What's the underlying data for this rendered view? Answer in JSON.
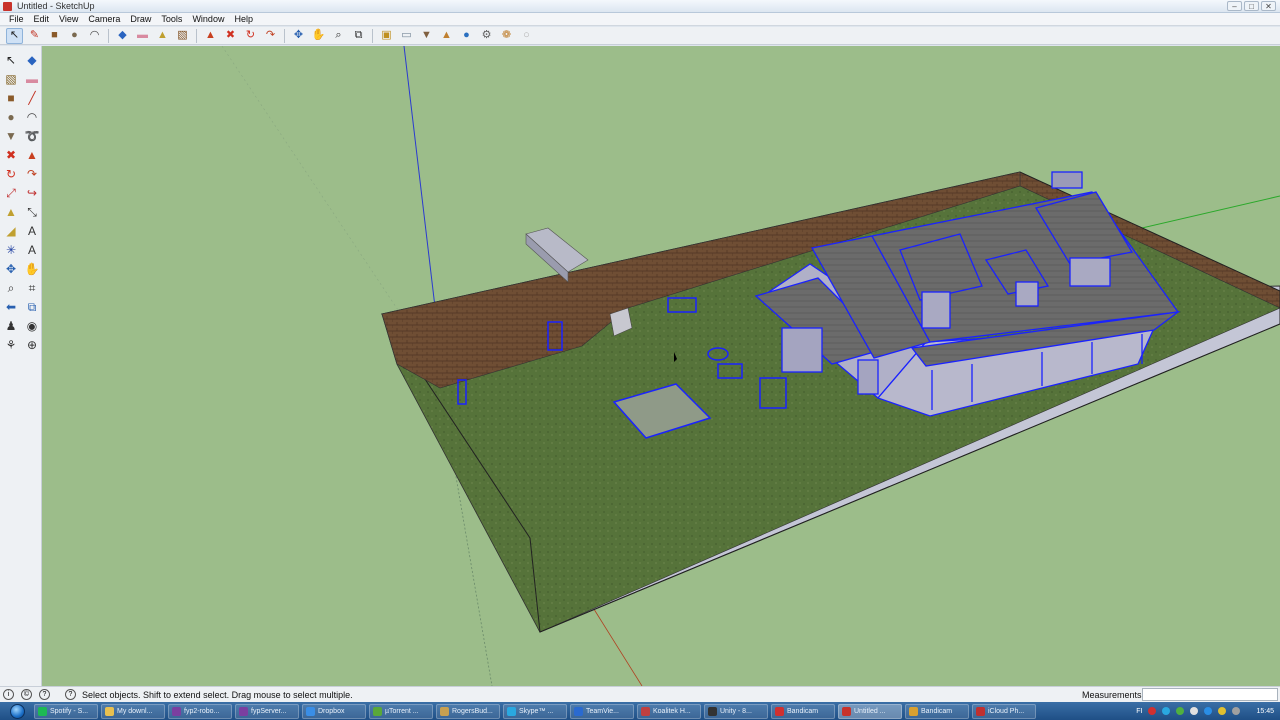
{
  "window": {
    "title": "Untitled - SketchUp",
    "controls": [
      "–",
      "□",
      "✕"
    ]
  },
  "menu": [
    "File",
    "Edit",
    "View",
    "Camera",
    "Draw",
    "Tools",
    "Window",
    "Help"
  ],
  "toolbar": [
    {
      "name": "select-tool",
      "glyph": "↖",
      "color": "#222",
      "active": true
    },
    {
      "name": "pencil-tool",
      "glyph": "✎",
      "color": "#c03020"
    },
    {
      "name": "rectangle-tool",
      "glyph": "■",
      "color": "#8a5a2a"
    },
    {
      "name": "circle-tool",
      "glyph": "●",
      "color": "#7a6a50"
    },
    {
      "name": "arc-tool",
      "glyph": "◠",
      "color": "#444"
    },
    {
      "sep": true
    },
    {
      "name": "make-component-tool",
      "glyph": "◆",
      "color": "#2a64c0"
    },
    {
      "name": "eraser-tool",
      "glyph": "▬",
      "color": "#d88aa0"
    },
    {
      "name": "tape-measure-tool",
      "glyph": "▲",
      "color": "#c0a030"
    },
    {
      "name": "paint-bucket-tool",
      "glyph": "▧",
      "color": "#805020"
    },
    {
      "sep": true
    },
    {
      "name": "push-pull-tool",
      "glyph": "▲",
      "color": "#c84020"
    },
    {
      "name": "move-tool",
      "glyph": "✖",
      "color": "#d03020"
    },
    {
      "name": "rotate-tool",
      "glyph": "↻",
      "color": "#d03020"
    },
    {
      "name": "follow-me-tool",
      "glyph": "↷",
      "color": "#c04020"
    },
    {
      "sep": true
    },
    {
      "name": "orbit-tool",
      "glyph": "✥",
      "color": "#2860b0"
    },
    {
      "name": "pan-tool",
      "glyph": "✋",
      "color": "#806040"
    },
    {
      "name": "zoom-tool",
      "glyph": "⌕",
      "color": "#333"
    },
    {
      "name": "zoom-extents-tool",
      "glyph": "⧉",
      "color": "#333"
    },
    {
      "sep": true
    },
    {
      "name": "add-location-tool",
      "glyph": "▣",
      "color": "#c09020"
    },
    {
      "name": "toggle-terrain-tool",
      "glyph": "▭",
      "color": "#7a8a9a"
    },
    {
      "name": "get-models-tool",
      "glyph": "▼",
      "color": "#806040"
    },
    {
      "name": "share-model-tool",
      "glyph": "▲",
      "color": "#c08030"
    },
    {
      "name": "earth-tool",
      "glyph": "●",
      "color": "#2a70c0"
    },
    {
      "name": "extension-warehouse-tool",
      "glyph": "⚙",
      "color": "#606060"
    },
    {
      "name": "photo-textures-tool",
      "glyph": "❁",
      "color": "#c08030"
    },
    {
      "name": "preview-in-earth-tool",
      "glyph": "○",
      "color": "#b0b0b0"
    }
  ],
  "left_toolbar": [
    {
      "name": "select-tool",
      "glyph": "↖",
      "color": "#222"
    },
    {
      "name": "make-component-tool",
      "glyph": "◆",
      "color": "#2a64c0"
    },
    {
      "name": "paint-bucket-tool",
      "glyph": "▧",
      "color": "#806020"
    },
    {
      "name": "eraser-tool",
      "glyph": "▬",
      "color": "#d88aa0"
    },
    {
      "name": "rectangle-tool",
      "glyph": "■",
      "color": "#8a5a2a"
    },
    {
      "name": "line-tool",
      "glyph": "╱",
      "color": "#c03020"
    },
    {
      "name": "circle-tool",
      "glyph": "●",
      "color": "#7a6a50"
    },
    {
      "name": "arc-tool",
      "glyph": "◠",
      "color": "#444"
    },
    {
      "name": "polygon-tool",
      "glyph": "▼",
      "color": "#7a6a50"
    },
    {
      "name": "freehand-tool",
      "glyph": "➰",
      "color": "#444"
    },
    {
      "name": "move-tool",
      "glyph": "✖",
      "color": "#d03020"
    },
    {
      "name": "push-pull-tool",
      "glyph": "▲",
      "color": "#c84020"
    },
    {
      "name": "rotate-tool",
      "glyph": "↻",
      "color": "#d03020"
    },
    {
      "name": "follow-me-tool",
      "glyph": "↷",
      "color": "#c04020"
    },
    {
      "name": "scale-tool",
      "glyph": "⤢",
      "color": "#c03030"
    },
    {
      "name": "offset-tool",
      "glyph": "↪",
      "color": "#c03030"
    },
    {
      "name": "tape-measure-tool",
      "glyph": "▲",
      "color": "#c0a030"
    },
    {
      "name": "dimension-tool",
      "glyph": "⤡",
      "color": "#333"
    },
    {
      "name": "protractor-tool",
      "glyph": "◢",
      "color": "#c0a030"
    },
    {
      "name": "text-tool",
      "glyph": "A",
      "color": "#333"
    },
    {
      "name": "axes-tool",
      "glyph": "✳",
      "color": "#2040a0"
    },
    {
      "name": "3d-text-tool",
      "glyph": "A",
      "color": "#333"
    },
    {
      "name": "orbit-tool",
      "glyph": "✥",
      "color": "#2860b0"
    },
    {
      "name": "pan-tool",
      "glyph": "✋",
      "color": "#806040"
    },
    {
      "name": "zoom-tool",
      "glyph": "⌕",
      "color": "#333"
    },
    {
      "name": "zoom-window-tool",
      "glyph": "⌗",
      "color": "#333"
    },
    {
      "name": "previous-view-tool",
      "glyph": "⬅",
      "color": "#2860b0"
    },
    {
      "name": "zoom-extents-tool",
      "glyph": "⧉",
      "color": "#2860b0"
    },
    {
      "name": "position-camera-tool",
      "glyph": "♟",
      "color": "#333"
    },
    {
      "name": "look-around-tool",
      "glyph": "◉",
      "color": "#333"
    },
    {
      "name": "walk-tool",
      "glyph": "⚘",
      "color": "#333"
    },
    {
      "name": "section-plane-tool",
      "glyph": "⊕",
      "color": "#333"
    }
  ],
  "status": {
    "icons": [
      "i",
      "©",
      "?"
    ],
    "text": "Select objects. Shift to extend select. Drag mouse to select multiple.",
    "measurements_label": "Measurements",
    "measurements_value": ""
  },
  "taskbar": {
    "tasks": [
      {
        "label": "Spotify - S...",
        "color": "#1db954"
      },
      {
        "label": "My downl...",
        "color": "#e8c050"
      },
      {
        "label": "fyp2-robo...",
        "color": "#7b3fa0"
      },
      {
        "label": "fypServer...",
        "color": "#7b3fa0"
      },
      {
        "label": "Dropbox",
        "color": "#3a8ee6"
      },
      {
        "label": "µTorrent ...",
        "color": "#5aa83a"
      },
      {
        "label": "RogersBud...",
        "color": "#c8a050"
      },
      {
        "label": "Skype™ ...",
        "color": "#2aa8e0"
      },
      {
        "label": "TeamVie...",
        "color": "#2a6ad0"
      },
      {
        "label": "Koalitek H...",
        "color": "#c04040"
      },
      {
        "label": "Unity - 8...",
        "color": "#333333"
      },
      {
        "label": "Bandicam",
        "color": "#d03030"
      },
      {
        "label": "Untitled ...",
        "color": "#c8332c",
        "active": true
      },
      {
        "label": "Bandicam",
        "color": "#d8a030"
      },
      {
        "label": "iCloud Ph...",
        "color": "#c03030"
      }
    ],
    "lang": "FI",
    "tray_icons": [
      "#d03030",
      "#2aa8e0",
      "#50b040",
      "#e0e0e0",
      "#2a8ee6",
      "#e0c030",
      "#a0a0a0"
    ],
    "clock": "15:45"
  }
}
